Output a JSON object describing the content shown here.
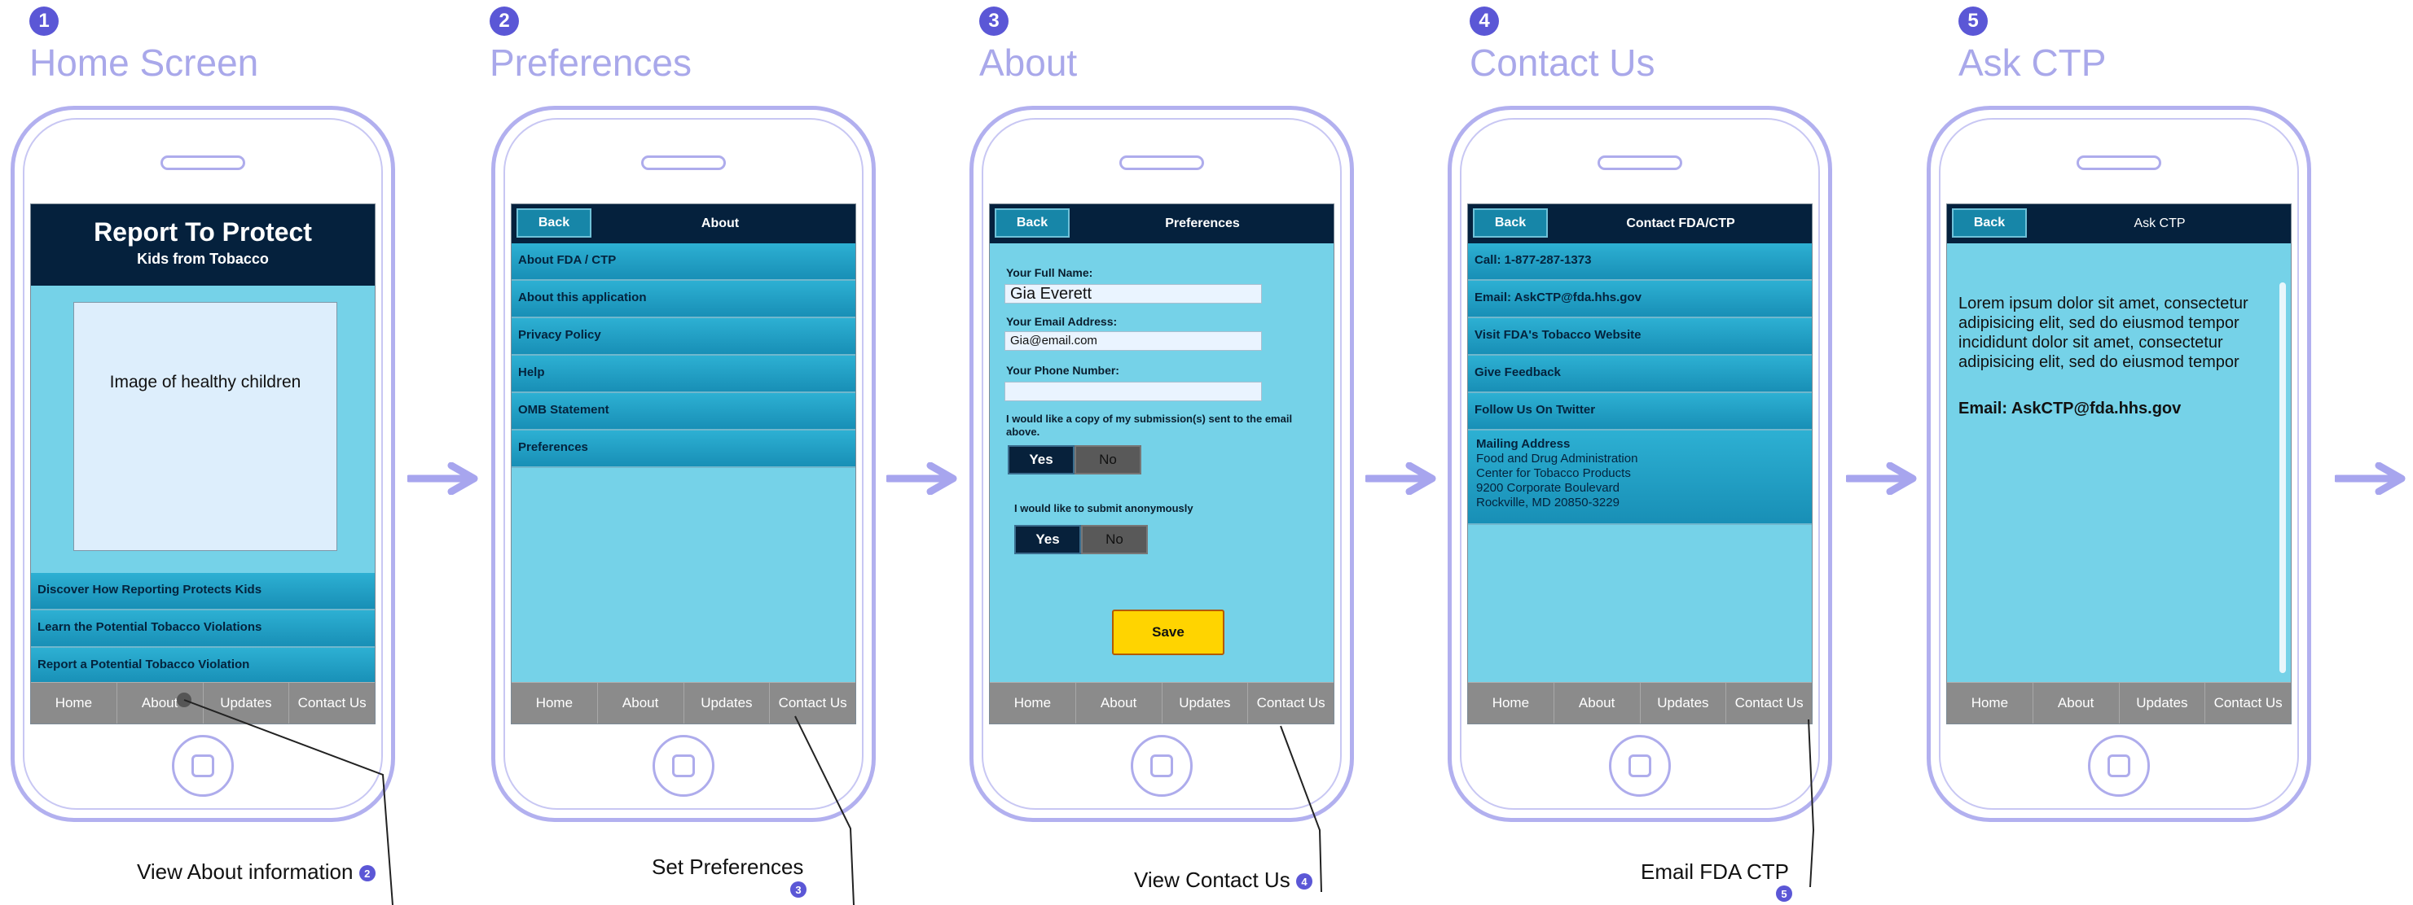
{
  "steps": [
    {
      "num": "1",
      "title": "Home Screen"
    },
    {
      "num": "2",
      "title": "Preferences"
    },
    {
      "num": "3",
      "title": "About"
    },
    {
      "num": "4",
      "title": "Contact Us"
    },
    {
      "num": "5",
      "title": "Ask CTP"
    }
  ],
  "tabbar": {
    "home": "Home",
    "about": "About",
    "updates": "Updates",
    "contact": "Contact Us"
  },
  "back_label": "Back",
  "home_screen": {
    "title": "Report To Protect",
    "subtitle": "Kids from Tobacco",
    "image_placeholder": "Image of healthy children",
    "menu": [
      "Discover How Reporting Protects Kids",
      "Learn the Potential Tobacco Violations",
      "Report a Potential Tobacco Violation"
    ]
  },
  "about_screen": {
    "header": "About",
    "menu": [
      "About FDA / CTP",
      "About this application",
      "Privacy Policy",
      "Help",
      "OMB Statement",
      "Preferences"
    ]
  },
  "prefs_screen": {
    "header": "Preferences",
    "name_label": "Your Full Name:",
    "name_value": "Gia Everett",
    "email_label": "Your Email Address:",
    "email_value": "Gia@email.com",
    "phone_label": "Your Phone Number:",
    "phone_value": "",
    "copy_question": "I would like a copy of my submission(s) sent to the email above.",
    "anon_question": "I would like to submit anonymously",
    "yes": "Yes",
    "no": "No",
    "save": "Save"
  },
  "contact_screen": {
    "header": "Contact FDA/CTP",
    "menu": [
      "Call: 1-877-287-1373",
      "Email: AskCTP@fda.hhs.gov",
      "Visit FDA's Tobacco Website",
      "Give Feedback",
      "Follow Us On Twitter"
    ],
    "mailing_title": "Mailing Address",
    "mailing_lines": [
      "Food and Drug Administration",
      "Center for Tobacco Products",
      "9200 Corporate Boulevard",
      "Rockville, MD 20850-3229"
    ]
  },
  "askctp_screen": {
    "header": "Ask CTP",
    "body": "Lorem ipsum dolor sit amet, consectetur adipisicing elit, sed do eiusmod tempor incididunt dolor sit amet, consectetur adipisicing elit, sed do eiusmod tempor",
    "email": "Email: AskCTP@fda.hhs.gov"
  },
  "annotations": [
    {
      "text": "View About information",
      "num": "2"
    },
    {
      "text": "Set Preferences",
      "num": "3"
    },
    {
      "text": "View Contact Us",
      "num": "4"
    },
    {
      "text": "Email FDA CTP",
      "num": "5"
    }
  ],
  "colors": {
    "accent": "#5b57d6",
    "title": "#a9a8ea",
    "phone_outline": "#b2b0ef",
    "screen_bg": "#75d2e8",
    "header_bg": "#05213d",
    "arrow": "#a7a5ee"
  }
}
